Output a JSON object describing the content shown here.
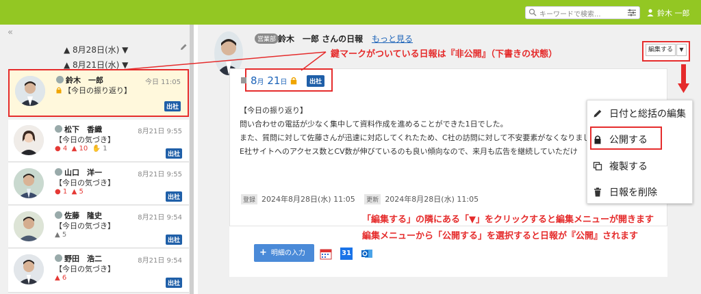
{
  "topbar": {
    "search_placeholder": "キーワードで検索...",
    "user_name": "鈴木 一郎"
  },
  "sidebar": {
    "collapse_glyph": "«",
    "date_groups": [
      "8月28日(水)",
      "8月21日(水)"
    ],
    "entries": [
      {
        "name": "鈴木　一郎",
        "time": "今日 11:05",
        "summary": "【今日の振り返り】",
        "status": "出社",
        "locked": true,
        "stats": []
      },
      {
        "name": "松下　香織",
        "time": "8月21日 9:55",
        "summary": "【今日の気づき】",
        "status": "出社",
        "locked": false,
        "stats": [
          "4",
          "10",
          "1"
        ]
      },
      {
        "name": "山口　洋一",
        "time": "8月21日 9:55",
        "summary": "【今日の気づき】",
        "status": "出社",
        "locked": false,
        "stats": [
          "1",
          "5"
        ]
      },
      {
        "name": "佐藤　隆史",
        "time": "8月21日 9:54",
        "summary": "【今日の気づき】",
        "status": "出社",
        "locked": false,
        "stats": [
          "5"
        ]
      },
      {
        "name": "野田　浩二",
        "time": "8月21日 9:54",
        "summary": "【今日の気づき】",
        "status": "出社",
        "locked": false,
        "stats": [
          "6"
        ]
      }
    ]
  },
  "report": {
    "dept": "営業部",
    "title": "鈴木　一郎 さんの日報",
    "more_link": "もっと見る",
    "date_month": "8",
    "date_month_unit": "月",
    "date_day": "21",
    "date_day_unit": "日",
    "status": "出社",
    "edit_label": "編集する",
    "caret": "▼",
    "body": [
      "【今日の振り返り】",
      "問い合わせの電話が少なく集中して資料作成を進めることができた1日でした。",
      "また、質問に対して佐藤さんが迅速に対応してくれたため、C社の訪問に対して不安要素がなくなりました",
      "E社サイトへのアクセス数とCV数が伸びているのも良い傾向なので、来月も広告を継続していただけ"
    ],
    "registered_tag": "登録",
    "registered": "2024年8月28日(水) 11:05",
    "updated_tag": "更新",
    "updated": "2024年8月28日(水) 11:05",
    "add_detail": "明細の入力",
    "outlook_day": "31"
  },
  "edit_menu": {
    "items": [
      "日付と総括の編集",
      "公開する",
      "複製する",
      "日報を削除"
    ]
  },
  "annotations": {
    "lock_note": "鍵マークがついている日報は『非公開』（下書きの状態）",
    "menu_note_1": "「編集する」の隣にある「▼」をクリックすると編集メニューが開きます",
    "menu_note_2": "編集メニューから「公開する」を選択すると日報が『公開』されます"
  },
  "colors": {
    "topbar": "#93c723",
    "accent_red": "#e52b2b",
    "badge_blue": "#1f5fa8",
    "link_blue": "#1a62b8"
  }
}
